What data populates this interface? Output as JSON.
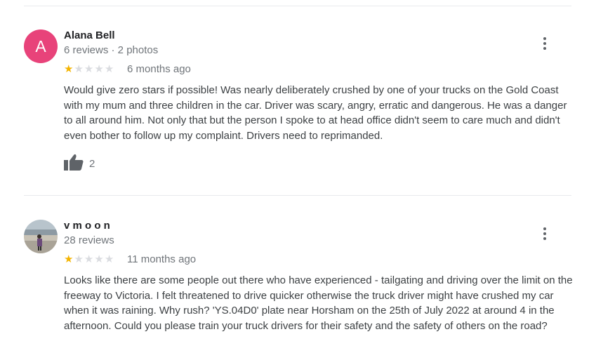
{
  "reviews": [
    {
      "avatar_letter": "A",
      "author": "Alana Bell",
      "meta": "6 reviews · 2 photos",
      "rating": 1,
      "date": "6 months ago",
      "text": "Would give zero stars if possible! Was nearly deliberately crushed by one of your trucks on the Gold Coast with my mum and three children in the car. Driver was scary, angry, erratic and dangerous. He was a danger to all around him. Not only that but the person I spoke to at head office didn't seem to care much and didn't even bother to follow up my complaint. Drivers need to reprimanded.",
      "likes": "2"
    },
    {
      "author": "v m o o n",
      "meta": "28 reviews",
      "rating": 1,
      "date": "11 months ago",
      "text": "Looks like there are some people out there who have experienced - tailgating and driving over the limit on the freeway to Victoria. I felt threatened to drive quicker otherwise the truck driver might have crushed my car when it was raining. Why rush? 'YS.04D0' plate near Horsham on the 25th of July 2022 at around 4 in the afternoon. Could you please train your truck drivers for their safety and the safety of others on the road?"
    }
  ],
  "colors": {
    "avatar_bg": "#e8437a",
    "star_filled": "#f4b400",
    "star_empty": "#dadce0"
  },
  "icons": {
    "more": "more-vert-icon",
    "like": "thumbs-up-icon",
    "star": "star-icon"
  }
}
